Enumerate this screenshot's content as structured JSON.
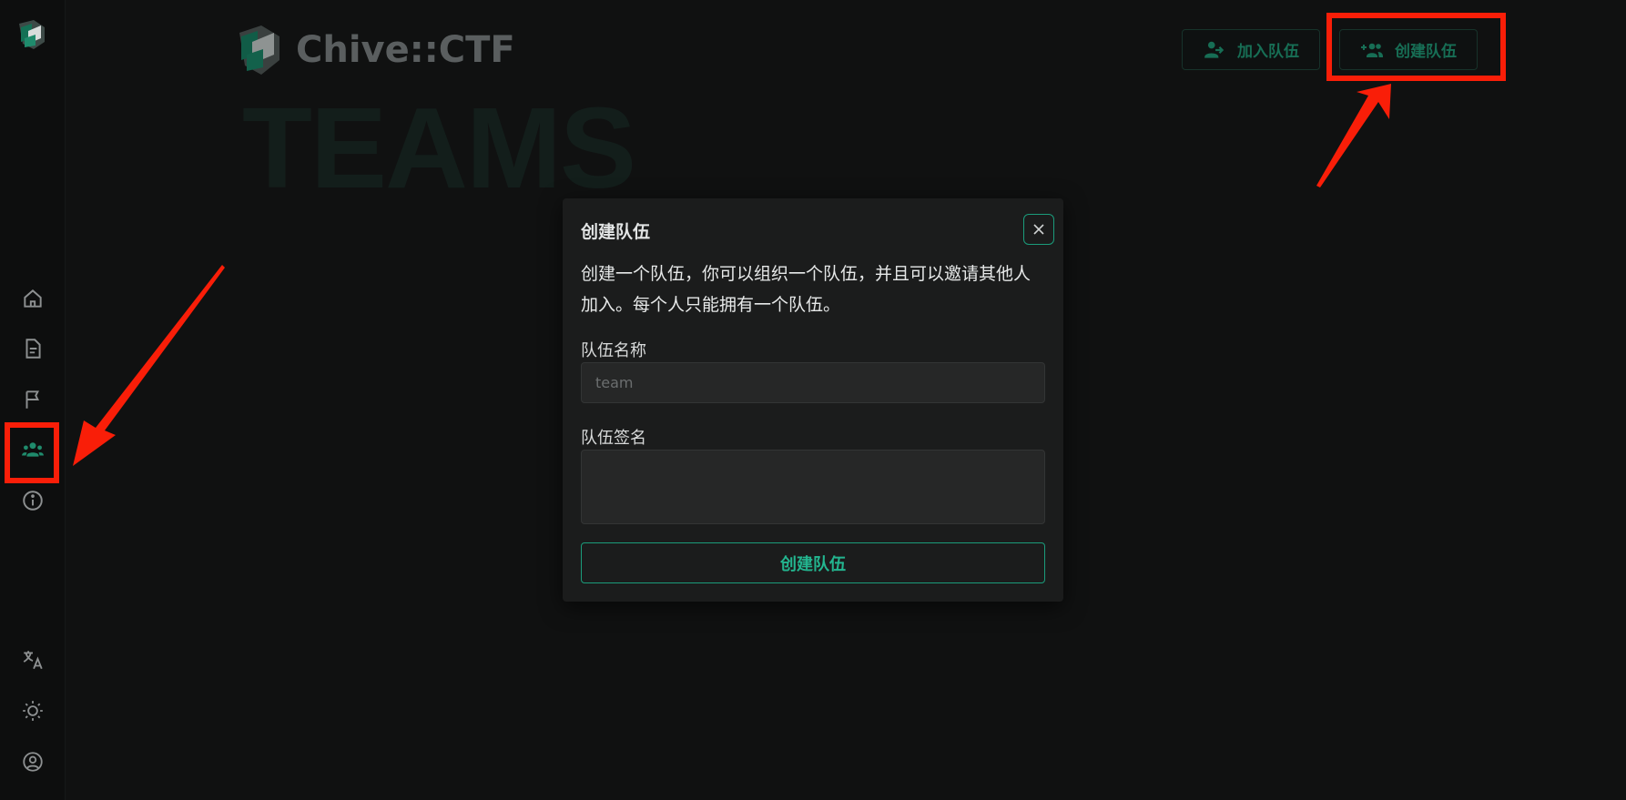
{
  "brand": {
    "name": "Chive::CTF"
  },
  "hero": {
    "title": "TEAMS"
  },
  "header": {
    "join_label": "加入队伍",
    "create_label": "创建队伍"
  },
  "sidebar": {
    "items": [
      {
        "name": "home",
        "icon": "home-icon"
      },
      {
        "name": "posts",
        "icon": "document-icon"
      },
      {
        "name": "challenges",
        "icon": "flag-icon"
      },
      {
        "name": "teams",
        "icon": "team-icon",
        "active": true
      },
      {
        "name": "about",
        "icon": "info-icon"
      }
    ],
    "bottom": [
      {
        "name": "language",
        "icon": "translate-icon"
      },
      {
        "name": "theme",
        "icon": "brightness-icon"
      },
      {
        "name": "account",
        "icon": "account-circle-icon"
      }
    ]
  },
  "modal": {
    "title": "创建队伍",
    "description": "创建一个队伍，你可以组织一个队伍，并且可以邀请其他人加入。每个人只能拥有一个队伍。",
    "name_label": "队伍名称",
    "name_placeholder": "team",
    "name_value": "",
    "bio_label": "队伍签名",
    "bio_value": "",
    "submit_label": "创建队伍"
  },
  "colors": {
    "accent": "#1b9c7b",
    "annotation": "#f91e08",
    "background": "#101111"
  }
}
